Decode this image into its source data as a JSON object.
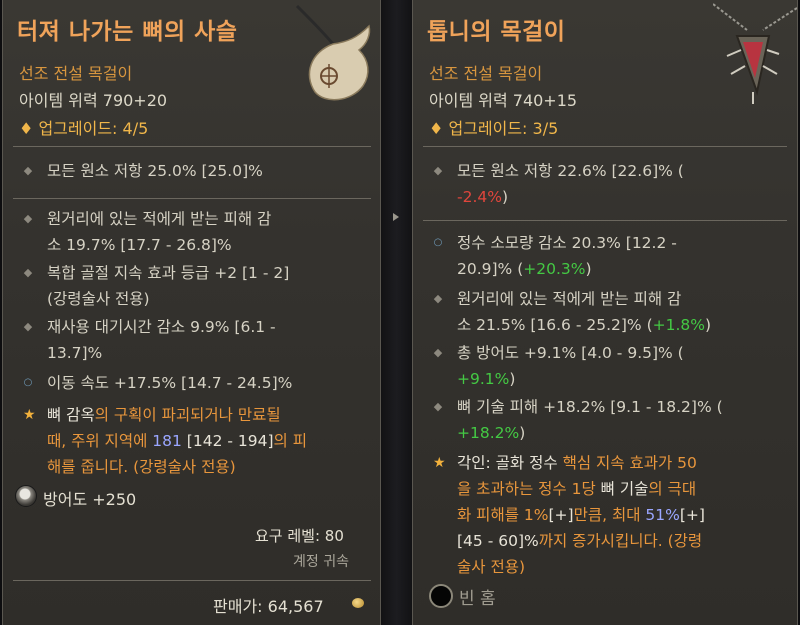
{
  "left": {
    "title": "터져 나가는 뼈의 사슬",
    "type": "선조 전설 목걸이",
    "power": "아이템 위력 790+20",
    "upgrade": "업그레이드: 4/5",
    "stats": [
      {
        "bullet": "diamond",
        "lines": [
          "모든 원소 저항 25.0% [25.0]%"
        ]
      },
      {
        "bullet": "diamond",
        "lines": [
          "원거리에 있는 적에게 받는 피해 감",
          "소 19.7% [17.7 - 26.8]%"
        ]
      },
      {
        "bullet": "diamond",
        "lines": [
          "복합 골절 지속 효과 등급 +2 [1 - 2]",
          "(강령술사 전용)"
        ]
      },
      {
        "bullet": "diamond",
        "lines": [
          "재사용 대기시간 감소 9.9% [6.1 -",
          "13.7]%"
        ]
      },
      {
        "bullet": "circle",
        "lines": [
          "이동 속도 +17.5% [14.7 - 24.5]%"
        ]
      }
    ],
    "legendary": {
      "line1_white": "뼈 감옥",
      "line1_orange": "의 구획이 파괴되거나 만료될",
      "line2_orange_a": "때, 주위 지역에 ",
      "line2_blue": "181",
      "line2_white": " [142 - 194]",
      "line2_orange_b": "의 피",
      "line3_orange": "해를 줍니다. (강령술사 전용)"
    },
    "armor": "방어도 +250",
    "requirement": "요구 레벨: 80",
    "bound": "계정 귀속",
    "price": "판매가: 64,567"
  },
  "right": {
    "title": "톱니의 목걸이",
    "type": "선조 전설 목걸이",
    "power": "아이템 위력 740+15",
    "upgrade": "업그레이드: 3/5",
    "stat1_line1": "모든 원소 저항 22.6% [22.6]% (",
    "stat1_line2_delta": "-2.4%",
    "stat1_line2_end": ")",
    "stat2_line1": "정수 소모량 감소 20.3% [12.2 -",
    "stat2_line2": "20.9]% (",
    "stat2_delta": "+20.3%",
    "stat2_end": ")",
    "stat3_line1": "원거리에 있는 적에게 받는 피해 감",
    "stat3_line2": "소 21.5% [16.6 - 25.2]% (",
    "stat3_delta": "+1.8%",
    "stat3_end": ")",
    "stat4_line1": "총 방어도 +9.1% [4.0 - 9.5]% (",
    "stat4_delta": "+9.1%",
    "stat4_end": ")",
    "stat5_line1": "뼈 기술 피해 +18.2% [9.1 - 18.2]% (",
    "stat5_delta": "+18.2%",
    "stat5_end": ")",
    "aspect": {
      "l1_white": "각인: 골화 정수 ",
      "l1_orange": "핵심 지속 효과가 50",
      "l2_orange_a": "을 초과하는 정수 1당 ",
      "l2_white": "뼈 기술",
      "l2_orange_b": "의 극대",
      "l3_orange": "화 피해를 1%",
      "l3_white": "[+]",
      "l3_orange_b": "만큼, 최대 ",
      "l3_blue": "51%",
      "l3_white_b": "[+]",
      "l4_white": "[45 - 60]%",
      "l4_orange": "까지 증가시킵니다. (강령",
      "l5_orange": "술사 전용)"
    },
    "socket": "빈 홈"
  }
}
